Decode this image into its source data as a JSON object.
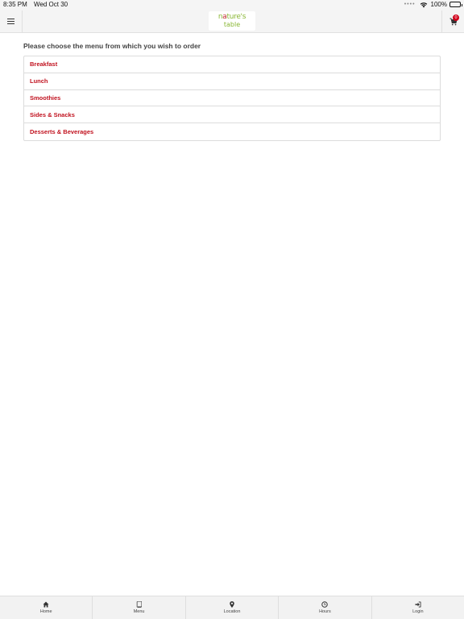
{
  "status_bar": {
    "time": "8:35 PM",
    "date": "Wed Oct 30",
    "battery": "100%"
  },
  "header": {
    "logo_line1_a": "n",
    "logo_line1_dot": "a",
    "logo_line1_b": "ture's",
    "logo_line2": "table",
    "cart_count": "0",
    "icons": {
      "menu": "hamburger-icon",
      "cart": "cart-icon"
    }
  },
  "main": {
    "prompt": "Please choose the menu from which you wish to order",
    "menus": [
      {
        "label": "Breakfast"
      },
      {
        "label": "Lunch"
      },
      {
        "label": "Smoothies"
      },
      {
        "label": "Sides & Snacks"
      },
      {
        "label": "Desserts & Beverages"
      }
    ]
  },
  "tabbar": {
    "tabs": [
      {
        "label": "Home",
        "icon": "home-icon"
      },
      {
        "label": "Menu",
        "icon": "book-icon"
      },
      {
        "label": "Location",
        "icon": "map-pin-icon"
      },
      {
        "label": "Hours",
        "icon": "clock-icon"
      },
      {
        "label": "Login",
        "icon": "sign-in-icon"
      }
    ]
  },
  "colors": {
    "accent": "#c1121f",
    "logo_green": "#8ab735",
    "badge": "#d0021b"
  }
}
